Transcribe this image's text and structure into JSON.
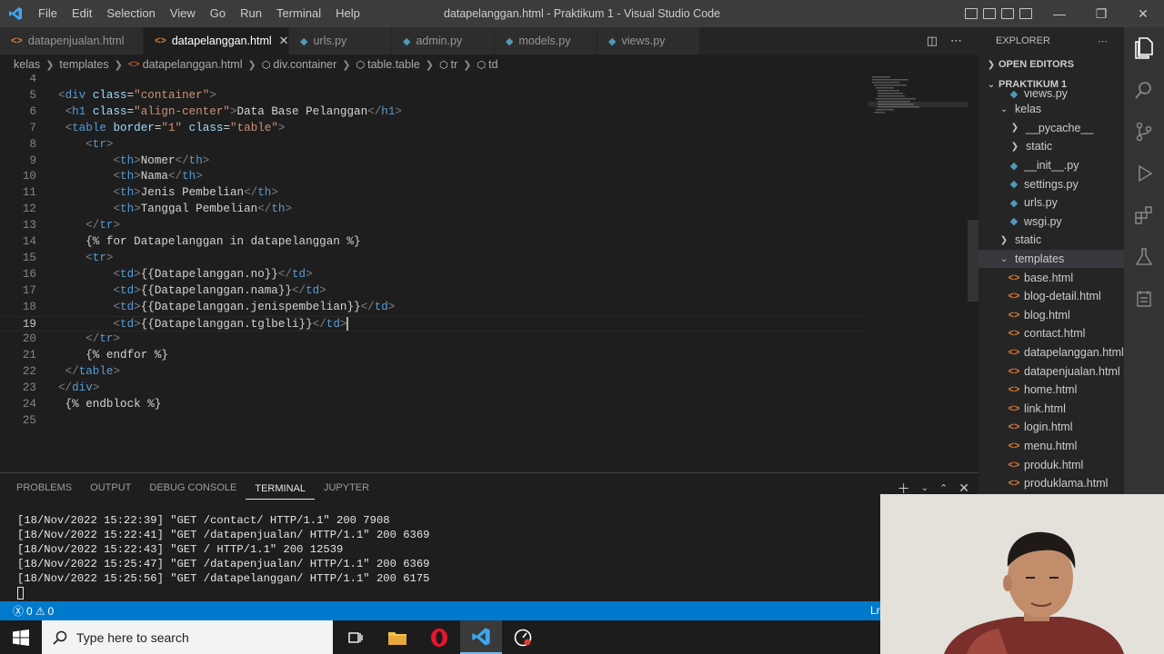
{
  "window": {
    "title": "datapelanggan.html - Praktikum 1 - Visual Studio Code",
    "menu": [
      "File",
      "Edit",
      "Selection",
      "View",
      "Go",
      "Run",
      "Terminal",
      "Help"
    ]
  },
  "tabs": [
    {
      "label": "datapenjualan.html",
      "icon": "html",
      "active": false
    },
    {
      "label": "datapelanggan.html",
      "icon": "html",
      "active": true
    },
    {
      "label": "urls.py",
      "icon": "py",
      "active": false
    },
    {
      "label": "admin.py",
      "icon": "py",
      "active": false
    },
    {
      "label": "models.py",
      "icon": "py",
      "active": false
    },
    {
      "label": "views.py",
      "icon": "py",
      "active": false
    }
  ],
  "breadcrumb": [
    "kelas",
    "templates",
    "datapelanggan.html",
    "div.container",
    "table.table",
    "tr",
    "td"
  ],
  "editor": {
    "current_line": 19,
    "lines": [
      {
        "n": "4",
        "tokens": []
      },
      {
        "n": "5",
        "tokens": [
          [
            "br",
            "<"
          ],
          [
            "tg",
            "div"
          ],
          [
            "tx",
            " "
          ],
          [
            "at",
            "class"
          ],
          [
            "tx",
            "="
          ],
          [
            "st",
            "\"container\""
          ],
          [
            "br",
            ">"
          ]
        ]
      },
      {
        "n": "6",
        "tokens": [
          [
            "tx",
            " "
          ],
          [
            "br",
            "<"
          ],
          [
            "tg",
            "h1"
          ],
          [
            "tx",
            " "
          ],
          [
            "at",
            "class"
          ],
          [
            "tx",
            "="
          ],
          [
            "st",
            "\"align-center\""
          ],
          [
            "br",
            ">"
          ],
          [
            "tx",
            "Data Base Pelanggan"
          ],
          [
            "br",
            "</"
          ],
          [
            "tg",
            "h1"
          ],
          [
            "br",
            ">"
          ]
        ]
      },
      {
        "n": "7",
        "tokens": [
          [
            "tx",
            " "
          ],
          [
            "br",
            "<"
          ],
          [
            "tg",
            "table"
          ],
          [
            "tx",
            " "
          ],
          [
            "at",
            "border"
          ],
          [
            "tx",
            "="
          ],
          [
            "st",
            "\"1\""
          ],
          [
            "tx",
            " "
          ],
          [
            "at",
            "class"
          ],
          [
            "tx",
            "="
          ],
          [
            "st",
            "\"table\""
          ],
          [
            "br",
            ">"
          ]
        ]
      },
      {
        "n": "8",
        "tokens": [
          [
            "tx",
            "    "
          ],
          [
            "br",
            "<"
          ],
          [
            "tg",
            "tr"
          ],
          [
            "br",
            ">"
          ]
        ]
      },
      {
        "n": "9",
        "tokens": [
          [
            "tx",
            "        "
          ],
          [
            "br",
            "<"
          ],
          [
            "tg",
            "th"
          ],
          [
            "br",
            ">"
          ],
          [
            "tx",
            "Nomer"
          ],
          [
            "br",
            "</"
          ],
          [
            "tg",
            "th"
          ],
          [
            "br",
            ">"
          ]
        ]
      },
      {
        "n": "10",
        "tokens": [
          [
            "tx",
            "        "
          ],
          [
            "br",
            "<"
          ],
          [
            "tg",
            "th"
          ],
          [
            "br",
            ">"
          ],
          [
            "tx",
            "Nama"
          ],
          [
            "br",
            "</"
          ],
          [
            "tg",
            "th"
          ],
          [
            "br",
            ">"
          ]
        ]
      },
      {
        "n": "11",
        "tokens": [
          [
            "tx",
            "        "
          ],
          [
            "br",
            "<"
          ],
          [
            "tg",
            "th"
          ],
          [
            "br",
            ">"
          ],
          [
            "tx",
            "Jenis Pembelian"
          ],
          [
            "br",
            "</"
          ],
          [
            "tg",
            "th"
          ],
          [
            "br",
            ">"
          ]
        ]
      },
      {
        "n": "12",
        "tokens": [
          [
            "tx",
            "        "
          ],
          [
            "br",
            "<"
          ],
          [
            "tg",
            "th"
          ],
          [
            "br",
            ">"
          ],
          [
            "tx",
            "Tanggal Pembelian"
          ],
          [
            "br",
            "</"
          ],
          [
            "tg",
            "th"
          ],
          [
            "br",
            ">"
          ]
        ]
      },
      {
        "n": "13",
        "tokens": [
          [
            "tx",
            "    "
          ],
          [
            "br",
            "</"
          ],
          [
            "tg",
            "tr"
          ],
          [
            "br",
            ">"
          ]
        ]
      },
      {
        "n": "14",
        "tokens": [
          [
            "tx",
            "    {% for Datapelanggan in datapelanggan %}"
          ]
        ]
      },
      {
        "n": "15",
        "tokens": [
          [
            "tx",
            "    "
          ],
          [
            "br",
            "<"
          ],
          [
            "tg",
            "tr"
          ],
          [
            "br",
            ">"
          ]
        ]
      },
      {
        "n": "16",
        "tokens": [
          [
            "tx",
            "        "
          ],
          [
            "br",
            "<"
          ],
          [
            "tg",
            "td"
          ],
          [
            "br",
            ">"
          ],
          [
            "tx",
            "{{Datapelanggan.no}}"
          ],
          [
            "br",
            "</"
          ],
          [
            "tg",
            "td"
          ],
          [
            "br",
            ">"
          ]
        ]
      },
      {
        "n": "17",
        "tokens": [
          [
            "tx",
            "        "
          ],
          [
            "br",
            "<"
          ],
          [
            "tg",
            "td"
          ],
          [
            "br",
            ">"
          ],
          [
            "tx",
            "{{Datapelanggan.nama}}"
          ],
          [
            "br",
            "</"
          ],
          [
            "tg",
            "td"
          ],
          [
            "br",
            ">"
          ]
        ]
      },
      {
        "n": "18",
        "tokens": [
          [
            "tx",
            "        "
          ],
          [
            "br",
            "<"
          ],
          [
            "tg",
            "td"
          ],
          [
            "br",
            ">"
          ],
          [
            "tx",
            "{{Datapelanggan.jenispembelian}}"
          ],
          [
            "br",
            "</"
          ],
          [
            "tg",
            "td"
          ],
          [
            "br",
            ">"
          ]
        ]
      },
      {
        "n": "19",
        "tokens": [
          [
            "tx",
            "        "
          ],
          [
            "br",
            "<"
          ],
          [
            "tg",
            "td"
          ],
          [
            "br",
            ">"
          ],
          [
            "tx",
            "{{Datapelanggan.tglbeli}}"
          ],
          [
            "br",
            "</"
          ],
          [
            "tg",
            "td"
          ],
          [
            "br",
            ">"
          ]
        ]
      },
      {
        "n": "20",
        "tokens": [
          [
            "tx",
            "    "
          ],
          [
            "br",
            "</"
          ],
          [
            "tg",
            "tr"
          ],
          [
            "br",
            ">"
          ]
        ]
      },
      {
        "n": "21",
        "tokens": [
          [
            "tx",
            "    {% endfor %}"
          ]
        ]
      },
      {
        "n": "22",
        "tokens": [
          [
            "tx",
            " "
          ],
          [
            "br",
            "</"
          ],
          [
            "tg",
            "table"
          ],
          [
            "br",
            ">"
          ]
        ]
      },
      {
        "n": "23",
        "tokens": [
          [
            "br",
            "</"
          ],
          [
            "tg",
            "div"
          ],
          [
            "br",
            ">"
          ]
        ]
      },
      {
        "n": "24",
        "tokens": [
          [
            "tx",
            " {% endblock %}"
          ]
        ]
      },
      {
        "n": "25",
        "tokens": []
      }
    ]
  },
  "explorer": {
    "header": "EXPLORER",
    "open_editors": "OPEN EDITORS",
    "project": "PRAKTIKUM 1",
    "rows": [
      {
        "label": "views.py",
        "depth": 2,
        "kind": "py",
        "clipped": true
      },
      {
        "label": "kelas",
        "depth": 1,
        "kind": "folder-open"
      },
      {
        "label": "__pycache__",
        "depth": 2,
        "kind": "folder"
      },
      {
        "label": "static",
        "depth": 2,
        "kind": "folder"
      },
      {
        "label": "__init__.py",
        "depth": 2,
        "kind": "py"
      },
      {
        "label": "settings.py",
        "depth": 2,
        "kind": "py"
      },
      {
        "label": "urls.py",
        "depth": 2,
        "kind": "py"
      },
      {
        "label": "wsgi.py",
        "depth": 2,
        "kind": "py"
      },
      {
        "label": "static",
        "depth": 1,
        "kind": "folder"
      },
      {
        "label": "templates",
        "depth": 1,
        "kind": "folder-open",
        "selected": true
      },
      {
        "label": "base.html",
        "depth": 2,
        "kind": "html"
      },
      {
        "label": "blog-detail.html",
        "depth": 2,
        "kind": "html"
      },
      {
        "label": "blog.html",
        "depth": 2,
        "kind": "html"
      },
      {
        "label": "contact.html",
        "depth": 2,
        "kind": "html"
      },
      {
        "label": "datapelanggan.html",
        "depth": 2,
        "kind": "html"
      },
      {
        "label": "datapenjualan.html",
        "depth": 2,
        "kind": "html"
      },
      {
        "label": "home.html",
        "depth": 2,
        "kind": "html"
      },
      {
        "label": "link.html",
        "depth": 2,
        "kind": "html"
      },
      {
        "label": "login.html",
        "depth": 2,
        "kind": "html"
      },
      {
        "label": "menu.html",
        "depth": 2,
        "kind": "html"
      },
      {
        "label": "produk.html",
        "depth": 2,
        "kind": "html"
      },
      {
        "label": "produklama.html",
        "depth": 2,
        "kind": "html"
      }
    ]
  },
  "panel": {
    "tabs": [
      {
        "label": "PROBLEMS",
        "active": false
      },
      {
        "label": "OUTPUT",
        "active": false
      },
      {
        "label": "DEBUG CONSOLE",
        "active": false
      },
      {
        "label": "TERMINAL",
        "active": true
      },
      {
        "label": "JUPYTER",
        "active": false
      }
    ],
    "terminal_lines": [
      "[18/Nov/2022 15:22:39] \"GET /contact/ HTTP/1.1\" 200 7908",
      "[18/Nov/2022 15:22:41] \"GET /datapenjualan/ HTTP/1.1\" 200 6369",
      "[18/Nov/2022 15:22:43] \"GET / HTTP/1.1\" 200 12539",
      "[18/Nov/2022 15:25:47] \"GET /datapenjualan/ HTTP/1.1\" 200 6369",
      "[18/Nov/2022 15:25:56] \"GET /datapelanggan/ HTTP/1.1\" 200 6175"
    ]
  },
  "statusbar": {
    "errors": "0",
    "warnings": "0",
    "right_text": "Ln"
  },
  "taskbar": {
    "search_placeholder": "Type here to search"
  },
  "colors": {
    "accent": "#007acc",
    "titlebar": "#3c3c3c",
    "editor_bg": "#1e1e1e",
    "sidebar_bg": "#252526",
    "html_icon": "#e37933",
    "py_icon": "#519aba"
  }
}
